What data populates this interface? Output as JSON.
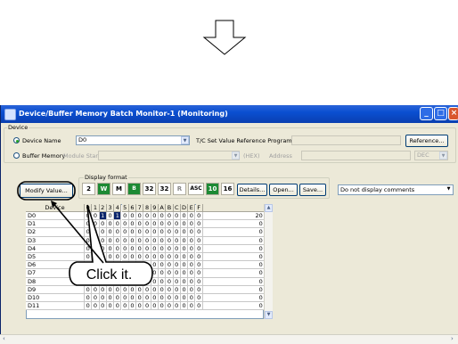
{
  "window": {
    "title": "Device/Buffer Memory Batch Monitor-1 (Monitoring)"
  },
  "device_group": {
    "label": "Device",
    "device_name_radio": "Device Name",
    "device_name_value": "D0",
    "tc_label": "T/C Set Value Reference Program",
    "reference_button": "Reference...",
    "buffer_memory_radio": "Buffer Memory",
    "module_start_label": "Module Start",
    "hex_label": "(HEX)",
    "address_label": "Address",
    "dec_label": "DEC"
  },
  "display_format": {
    "label": "Display format",
    "modify_button": "Modify Value...",
    "tools": [
      "2",
      "W",
      "M",
      "B",
      "32",
      "32",
      "R",
      "ASC",
      "10",
      "16"
    ],
    "details_button": "Details...",
    "open_button": "Open...",
    "save_button": "Save...",
    "comments_select": "Do not display comments"
  },
  "table": {
    "device_header": "Device",
    "bit_headers": [
      "0",
      "1",
      "2",
      "3",
      "4",
      "5",
      "6",
      "7",
      "8",
      "9",
      "A",
      "B",
      "C",
      "D",
      "E",
      "F"
    ],
    "rows": [
      {
        "device": "D0",
        "bits": [
          "0",
          "0",
          "1",
          "0",
          "1",
          "0",
          "0",
          "0",
          "0",
          "0",
          "0",
          "0",
          "0",
          "0",
          "0",
          "0"
        ],
        "value": "20"
      },
      {
        "device": "D1",
        "bits": [
          "0",
          "0",
          "0",
          "0",
          "0",
          "0",
          "0",
          "0",
          "0",
          "0",
          "0",
          "0",
          "0",
          "0",
          "0",
          "0"
        ],
        "value": "0"
      },
      {
        "device": "D2",
        "bits": [
          "0",
          "0",
          "0",
          "0",
          "0",
          "0",
          "0",
          "0",
          "0",
          "0",
          "0",
          "0",
          "0",
          "0",
          "0",
          "0"
        ],
        "value": "0"
      },
      {
        "device": "D3",
        "bits": [
          "0",
          "0",
          "0",
          "0",
          "0",
          "0",
          "0",
          "0",
          "0",
          "0",
          "0",
          "0",
          "0",
          "0",
          "0",
          "0"
        ],
        "value": "0"
      },
      {
        "device": "D4",
        "bits": [
          "0",
          "0",
          "0",
          "0",
          "0",
          "0",
          "0",
          "0",
          "0",
          "0",
          "0",
          "0",
          "0",
          "0",
          "0",
          "0"
        ],
        "value": "0"
      },
      {
        "device": "D5",
        "bits": [
          "0",
          "0",
          "0",
          "0",
          "0",
          "0",
          "0",
          "0",
          "0",
          "0",
          "0",
          "0",
          "0",
          "0",
          "0",
          "0"
        ],
        "value": "0"
      },
      {
        "device": "D6",
        "bits": [
          "0",
          "0",
          "0",
          "0",
          "0",
          "0",
          "0",
          "0",
          "0",
          "0",
          "0",
          "0",
          "0",
          "0",
          "0",
          "0"
        ],
        "value": "0"
      },
      {
        "device": "D7",
        "bits": [
          "0",
          "0",
          "0",
          "0",
          "0",
          "0",
          "0",
          "0",
          "0",
          "0",
          "0",
          "0",
          "0",
          "0",
          "0",
          "0"
        ],
        "value": "0"
      },
      {
        "device": "D8",
        "bits": [
          "0",
          "0",
          "0",
          "0",
          "0",
          "0",
          "0",
          "0",
          "0",
          "0",
          "0",
          "0",
          "0",
          "0",
          "0",
          "0"
        ],
        "value": "0"
      },
      {
        "device": "D9",
        "bits": [
          "0",
          "0",
          "0",
          "0",
          "0",
          "0",
          "0",
          "0",
          "0",
          "0",
          "0",
          "0",
          "0",
          "0",
          "0",
          "0"
        ],
        "value": "0"
      },
      {
        "device": "D10",
        "bits": [
          "0",
          "0",
          "0",
          "0",
          "0",
          "0",
          "0",
          "0",
          "0",
          "0",
          "0",
          "0",
          "0",
          "0",
          "0",
          "0"
        ],
        "value": "0"
      },
      {
        "device": "D11",
        "bits": [
          "0",
          "0",
          "0",
          "0",
          "0",
          "0",
          "0",
          "0",
          "0",
          "0",
          "0",
          "0",
          "0",
          "0",
          "0",
          "0"
        ],
        "value": "0"
      }
    ]
  },
  "callout": {
    "text": "Click it."
  }
}
